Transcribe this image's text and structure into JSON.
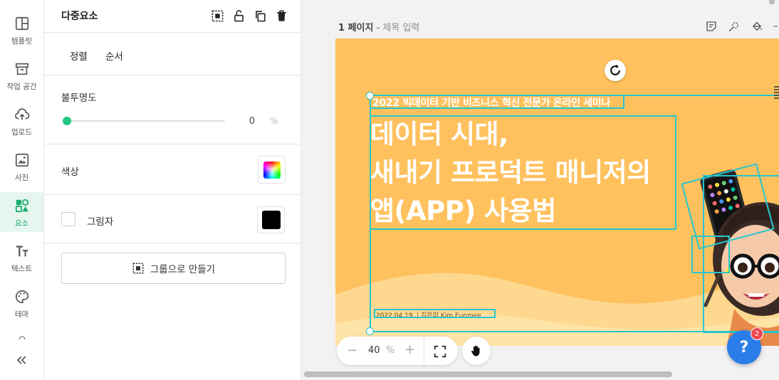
{
  "rail": {
    "items": [
      {
        "label": "템플릿",
        "icon": "template-icon"
      },
      {
        "label": "작업 공간",
        "icon": "archive-icon"
      },
      {
        "label": "업로드",
        "icon": "upload-icon"
      },
      {
        "label": "사진",
        "icon": "photo-icon"
      },
      {
        "label": "요소",
        "icon": "elements-icon",
        "active": true
      },
      {
        "label": "텍스트",
        "icon": "text-icon"
      },
      {
        "label": "테마",
        "icon": "palette-icon"
      }
    ],
    "collapse_label": "«"
  },
  "panel": {
    "title": "다중요소",
    "tabs": [
      "정렬",
      "순서"
    ],
    "opacity": {
      "label": "불투명도",
      "value": "0",
      "unit": "%",
      "level": 0
    },
    "color": {
      "label": "색상"
    },
    "shadow": {
      "label": "그림자",
      "checked": false,
      "color": "#000000"
    },
    "group_button": "그룹으로 만들기"
  },
  "workspace": {
    "page_number": "1 페이지",
    "page_separator": " - ",
    "page_title_placeholder": "제목 입력",
    "canvas": {
      "seminar": "2022 빅데이터 기반 비즈니스 혁신 전문가 온라인 세미나",
      "headline": [
        "데이터 시대,",
        "새내기 프로덕트 매니저의",
        "앱(APP) 사용법"
      ],
      "date_line": "2022.04.19.   |   김은미 Kim Eunmee",
      "background_color": "#ffc15e"
    },
    "zoom": {
      "minus": "−",
      "value": "40",
      "unit": "%",
      "plus": "+"
    },
    "help": {
      "symbol": "?",
      "badge": "2"
    }
  },
  "colors": {
    "accent": "#23c483",
    "selection": "#25c6cf",
    "help": "#2b7de9"
  }
}
